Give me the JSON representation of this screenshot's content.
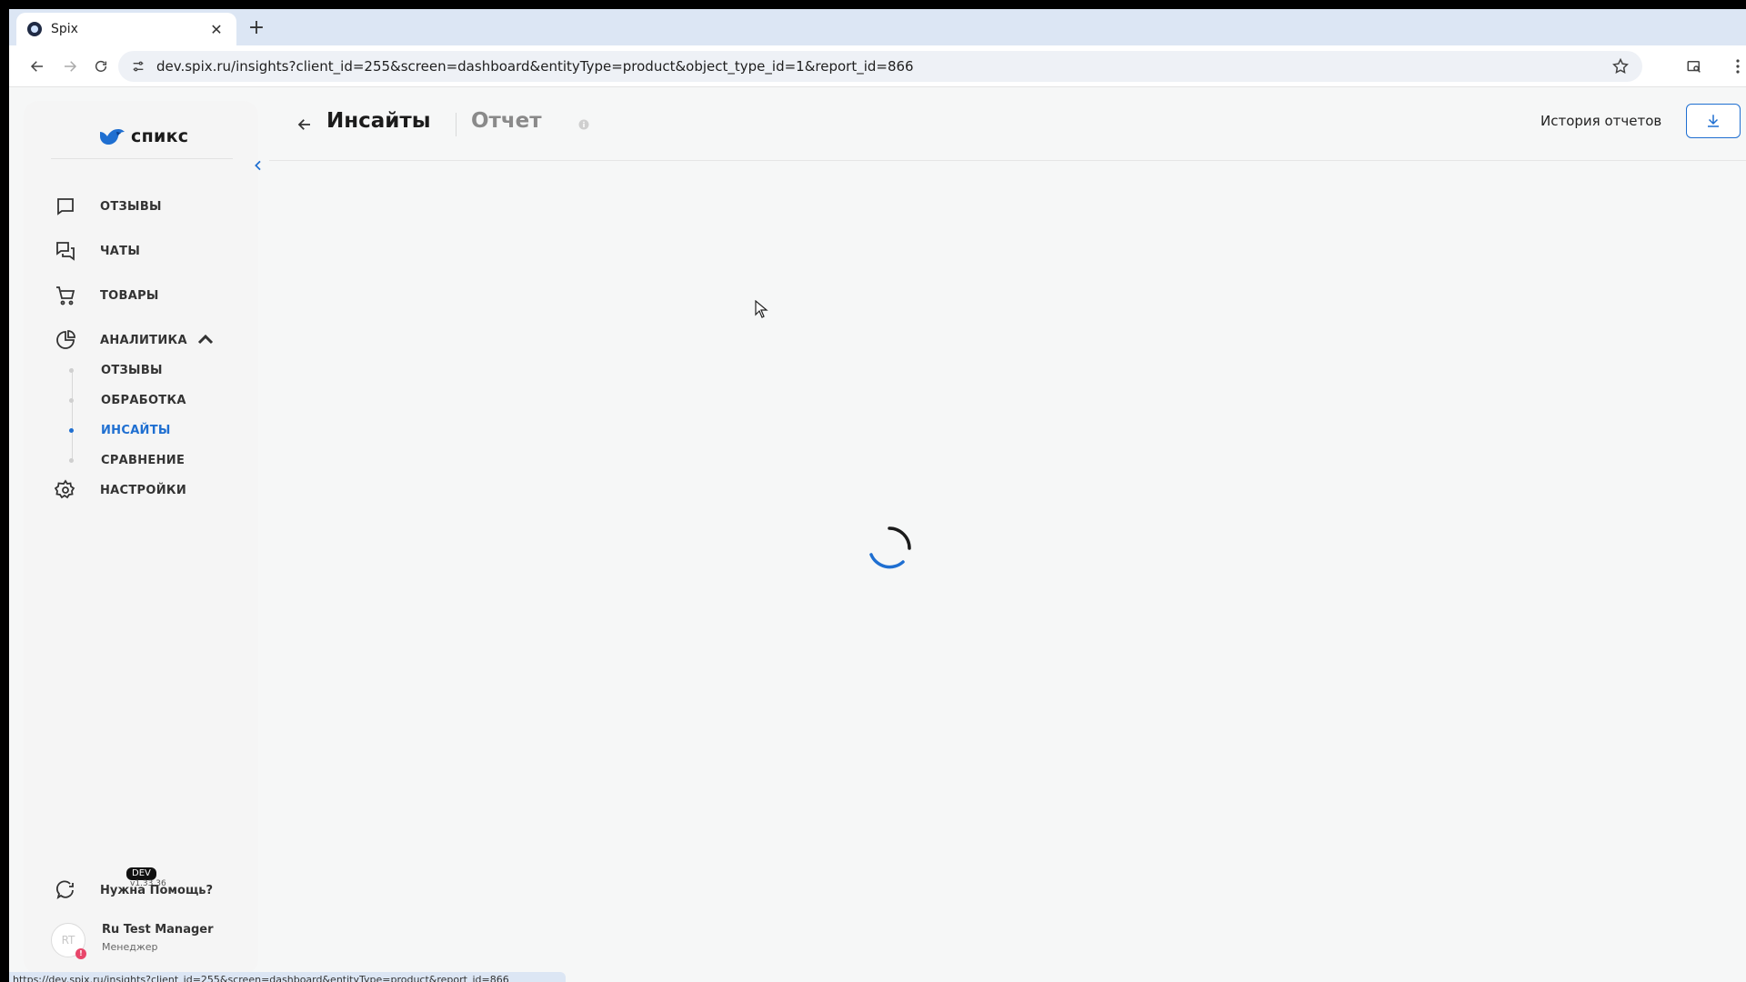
{
  "browser": {
    "tab_title": "Spix",
    "url": "dev.spix.ru/insights?client_id=255&screen=dashboard&entityType=product&object_type_id=1&report_id=866",
    "status_url": "https://dev.spix.ru/insights?client_id=255&screen=dashboard&entityType=product&report_id=866"
  },
  "sidebar": {
    "logo_text": "спикс",
    "items": [
      {
        "label": "ОТЗЫВЫ",
        "icon": "message-square-icon"
      },
      {
        "label": "ЧАТЫ",
        "icon": "chats-icon"
      },
      {
        "label": "ТОВАРЫ",
        "icon": "cart-icon"
      },
      {
        "label": "АНАЛИТИКА",
        "icon": "pie-chart-icon"
      },
      {
        "label": "НАСТРОЙКИ",
        "icon": "gear-icon"
      }
    ],
    "analytics_sub": [
      {
        "label": "ОТЗЫВЫ",
        "active": false
      },
      {
        "label": "ОБРАБОТКА",
        "active": false
      },
      {
        "label": "ИНСАЙТЫ",
        "active": true
      },
      {
        "label": "СРАВНЕНИЕ",
        "active": false
      }
    ],
    "help_label": "Нужна Помощь?",
    "user": {
      "initials": "RT",
      "name": "Ru Test Manager",
      "role": "Менеджер",
      "badge": "!"
    },
    "env_badge": "DEV",
    "version": "v1.33.36"
  },
  "header": {
    "title": "Инсайты",
    "subtitle": "Отчет",
    "history_label": "История отчетов"
  },
  "colors": {
    "accent": "#1f6fd1",
    "sidebar_bg": "#f5f5f5",
    "page_bg": "#f6f7f7"
  }
}
